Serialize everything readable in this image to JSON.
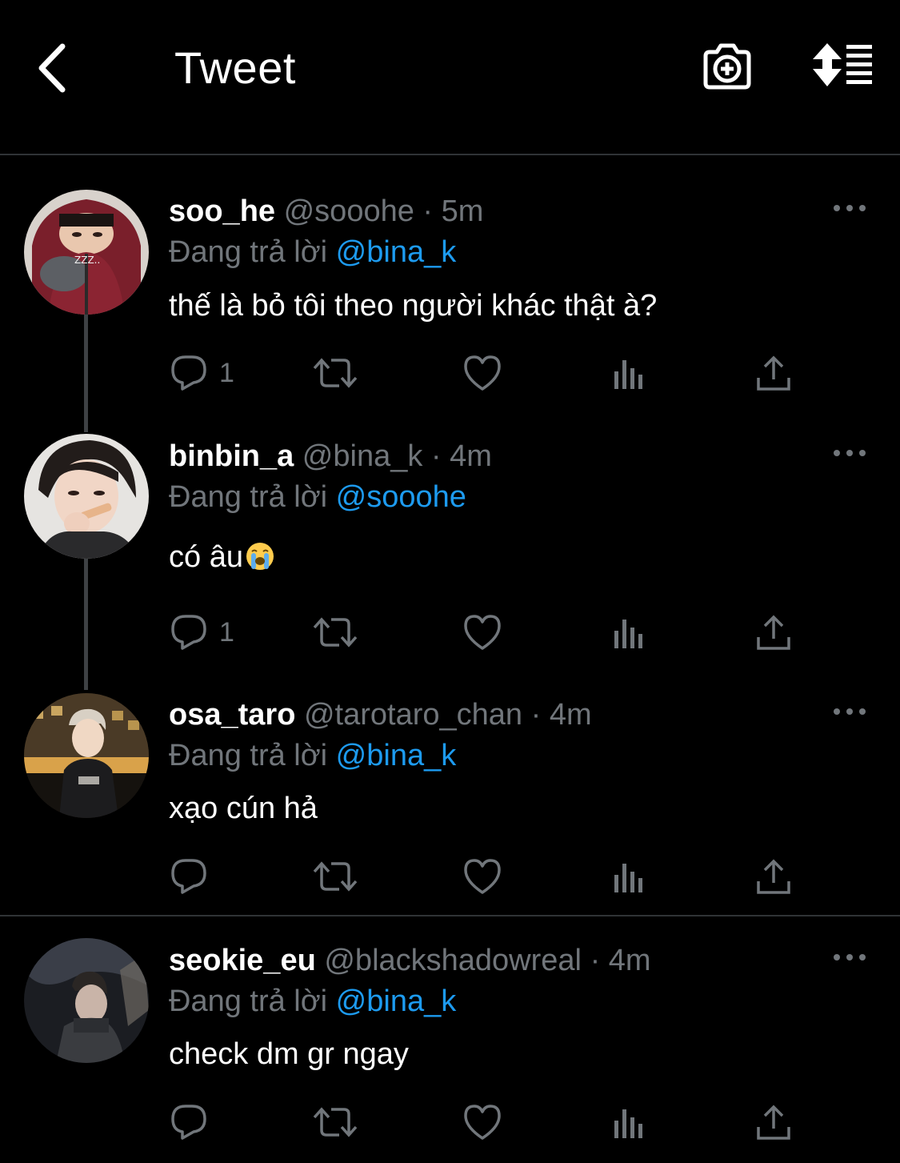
{
  "header": {
    "title": "Tweet",
    "back_icon": "chevron-left-icon",
    "camera_icon": "camera-plus-icon",
    "sort_icon": "sort-list-icon"
  },
  "colors": {
    "background": "#000000",
    "text": "#e7e9ea",
    "muted": "#71767b",
    "accent": "#1d9bf0",
    "divider": "#2f3336"
  },
  "reply_prefix": "Đang trả lời",
  "tweets": [
    {
      "display_name": "soo_he",
      "handle": "@sooohe",
      "separator": "·",
      "time": "5m",
      "reply_to": "@bina_k",
      "text": "thế là bỏ tôi theo người khác thật à?",
      "reply_count": "1"
    },
    {
      "display_name": "binbin_a",
      "handle": "@bina_k",
      "separator": "·",
      "time": "4m",
      "reply_to": "@sooohe",
      "text": "có âu",
      "emoji": "loudly-crying-face",
      "reply_count": "1"
    },
    {
      "display_name": "osa_taro",
      "handle": "@tarotaro_chan",
      "separator": "·",
      "time": "4m",
      "reply_to": "@bina_k",
      "text": "xạo cún hả",
      "reply_count": ""
    },
    {
      "display_name": "seokie_eu",
      "handle": "@blackshadowreal",
      "separator": "·",
      "time": "4m",
      "reply_to": "@bina_k",
      "text": "check dm gr ngay",
      "reply_count": ""
    }
  ]
}
